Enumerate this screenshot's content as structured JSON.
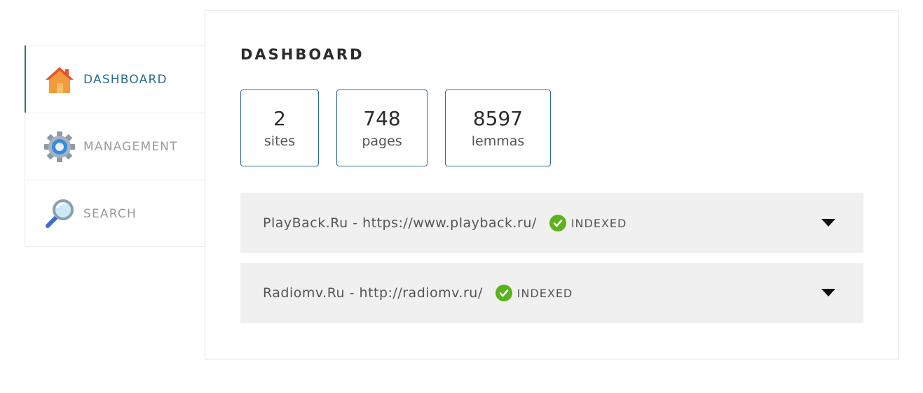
{
  "sidebar": {
    "items": [
      {
        "label": "DASHBOARD",
        "icon": "home-icon",
        "active": true
      },
      {
        "label": "MANAGEMENT",
        "icon": "gear-icon",
        "active": false
      },
      {
        "label": "SEARCH",
        "icon": "magnifier-icon",
        "active": false
      }
    ]
  },
  "main": {
    "title": "DASHBOARD",
    "stats": [
      {
        "value": "2",
        "label": "sites"
      },
      {
        "value": "748",
        "label": "pages"
      },
      {
        "value": "8597",
        "label": "lemmas"
      }
    ],
    "sites": [
      {
        "name": "PlayBack.Ru - https://www.playback.ru/",
        "status": "INDEXED"
      },
      {
        "name": "Radiomv.Ru - http://radiomv.ru/",
        "status": "INDEXED"
      }
    ]
  },
  "colors": {
    "accent": "#2a6e8e",
    "status_ok": "#5bb31b",
    "row_bg": "#f0f0f0"
  }
}
